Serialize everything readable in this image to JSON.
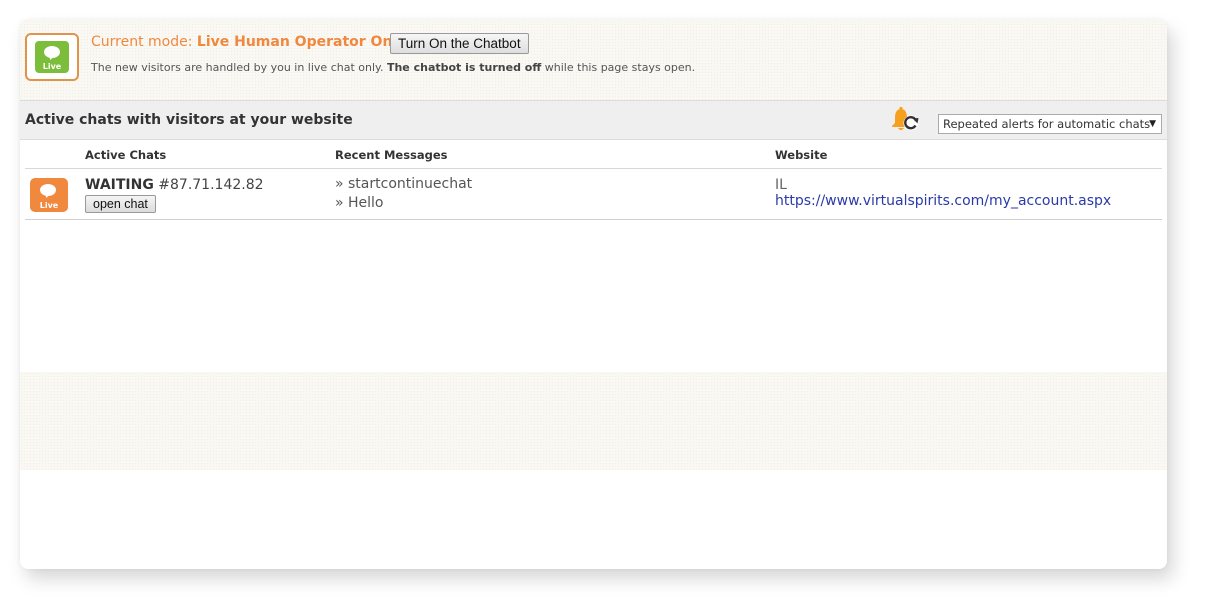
{
  "mode_bar": {
    "icon_label": "Live",
    "title_prefix": "Current mode:",
    "title_mode": "Live Human Operator Only",
    "toggle_button": "Turn On the Chatbot",
    "description_part1": "The new visitors are handled by you in live chat only.",
    "description_bold": "The chatbot is turned off",
    "description_part2": "while this page stays open."
  },
  "section": {
    "title": "Active chats with visitors at your website",
    "bell_icon": "bell-refresh-icon",
    "alert_select": {
      "selected": "Repeated alerts for automatic chats"
    }
  },
  "table": {
    "headers": [
      "Active Chats",
      "Recent Messages",
      "Website"
    ],
    "rows": [
      {
        "icon_label": "Live",
        "status": "WAITING",
        "visitor_id": "#87.71.142.82",
        "button": "open chat",
        "messages": [
          "» startcontinuechat",
          "» Hello"
        ],
        "country": "IL",
        "url": "https://www.virtualspirits.com/my_account.aspx"
      }
    ]
  },
  "colors": {
    "accent_orange": "#f0883e",
    "live_green": "#7dbd3c",
    "link_blue": "#2a3aa8"
  }
}
